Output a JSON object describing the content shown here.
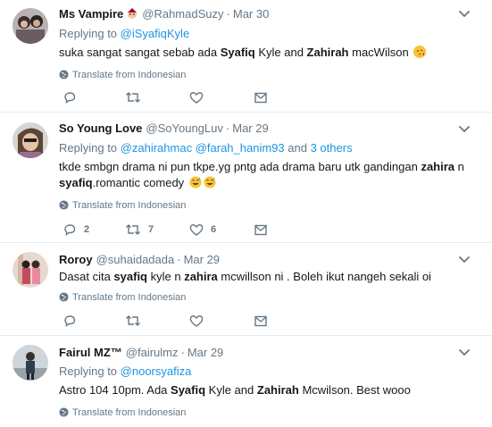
{
  "tweets": [
    {
      "name": "Ms Vampire",
      "handle": "@RahmadSuzy",
      "separator": "·",
      "time": "Mar 30",
      "replying_prefix": "Replying to",
      "replying_to": "@iSyafiqKyle",
      "text_parts": [
        "suka sangat sangat sebab ada ",
        "Syafiq",
        " Kyle and ",
        "Zahirah",
        " macWilson"
      ],
      "emoji": [
        "blowing-kiss-emoji"
      ],
      "translate": "Translate from Indonesian",
      "reply_count": "",
      "retweet_count": "",
      "like_count": ""
    },
    {
      "name": "So Young Love",
      "handle": "@SoYoungLuv",
      "separator": "·",
      "time": "Mar 29",
      "replying_prefix": "Replying to",
      "replying_to": "@zahirahmac",
      "replying_to_2": "@farah_hanim93",
      "replying_and": "and",
      "replying_others": "3 others",
      "text_line1": "tkde smbgn drama ni pun tkpe.yg pntg ada drama baru utk gandingan ",
      "text_bold1": "zahira",
      "text_line1_end": " n",
      "text_bold2": "syafiq",
      "text_line2": ".romantic comedy",
      "emoji": [
        "grinning-sweat-emoji",
        "grinning-sweat-emoji"
      ],
      "translate": "Translate from Indonesian",
      "reply_count": "2",
      "retweet_count": "7",
      "like_count": "6"
    },
    {
      "name": "Roroy",
      "handle": "@suhaidadada",
      "separator": "·",
      "time": "Mar 29",
      "text_parts": [
        "Dasat cita ",
        "syafiq",
        " kyle n ",
        "zahira",
        " mcwillson ni . Boleh ikut nangeh sekali oi"
      ],
      "translate": "Translate from Indonesian",
      "reply_count": "",
      "retweet_count": "",
      "like_count": ""
    },
    {
      "name": "Fairul MZ™",
      "handle": "@fairulmz",
      "separator": "·",
      "time": "Mar 29",
      "replying_prefix": "Replying to",
      "replying_to": "@noorsyafiza",
      "text_parts": [
        "Astro 104 10pm. Ada ",
        "Syafiq",
        " Kyle and ",
        "Zahirah",
        " Mcwilson. Best wooo"
      ],
      "translate": "Translate from Indonesian"
    }
  ],
  "colors": {
    "link": "#1b95e0",
    "muted": "#657786",
    "text": "#14171a",
    "divider": "#e6ecf0"
  },
  "icons": {
    "reply": "reply-icon",
    "retweet": "retweet-icon",
    "like": "heart-icon",
    "dm": "envelope-icon",
    "more": "chevron-down-icon",
    "translate": "globe-icon"
  }
}
